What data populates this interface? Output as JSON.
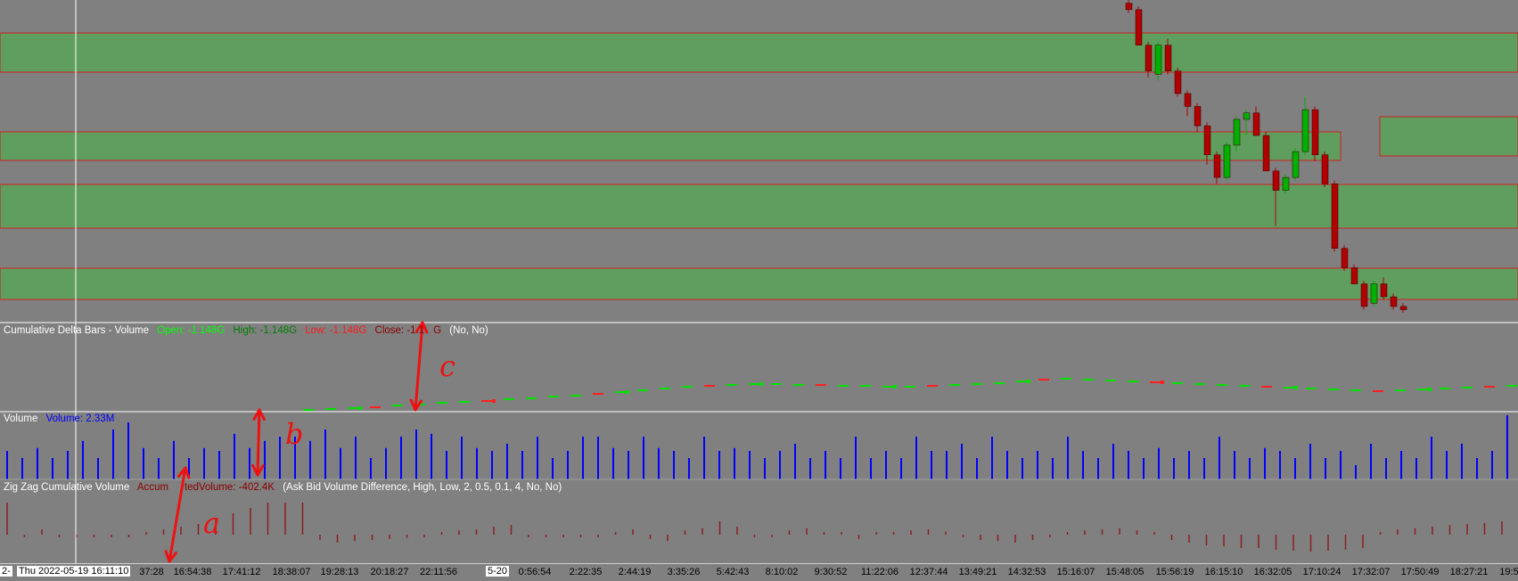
{
  "colors": {
    "background": "#808080",
    "zone_fill": "#5f9e5f",
    "zone_border": "#d02020",
    "candle_up": "#00b000",
    "candle_down": "#b00000",
    "volume_bar": "#0000ff",
    "zigzag_bar": "#8b2020",
    "annotation": "#ee1111",
    "crosshair": "#ffffff"
  },
  "panels": {
    "cumdelta": {
      "name": "Cumulative Delta Bars - Volume",
      "open": "Open: -1.148G",
      "high": "High: -1.148G",
      "low": "Low: -1.148G",
      "close": "Close: -1.1",
      "close_tail": "G",
      "params": "(No, No)"
    },
    "volume": {
      "name": "Volume",
      "value": "Volume: 2.33M"
    },
    "zigzag": {
      "name": "Zig Zag Cumulative Volume",
      "accum_a": "Accum",
      "accum_b": "tedVolume: -402.4K",
      "params": "(Ask Bid Volume Difference, High, Low, 2, 0.5, 0.1, 4, No, No)"
    }
  },
  "annotations": {
    "a": "a",
    "b": "b",
    "c": "c"
  },
  "time_axis": {
    "left_cut": "2-",
    "crosshair_time": "Thu 2022-05-19  16:11:10",
    "date_marker": "5-20",
    "ticks": [
      "37:28",
      "16:54:38",
      "17:41:12",
      "18:38:07",
      "19:28:13",
      "20:18:27",
      "22:11:56",
      "0:56:54",
      "2:22:35",
      "2:44:19",
      "3:35:26",
      "5:42:43",
      "8:10:02",
      "9:30:52",
      "11:22:06",
      "12:37:44",
      "13:49:21",
      "14:32:53",
      "15:16:07",
      "15:48:05",
      "15:56:19",
      "16:15:10",
      "16:32:05",
      "17:10:24",
      "17:32:07",
      "17:50:49",
      "18:27:21",
      "19:5"
    ]
  },
  "chart_data": {
    "type": "candlestick",
    "price_candles_ohlc_relative": [
      [
        0.99,
        0.97,
        1.0,
        0.96
      ],
      [
        0.97,
        0.86,
        0.98,
        0.86
      ],
      [
        0.86,
        0.78,
        0.87,
        0.76
      ],
      [
        0.77,
        0.86,
        0.87,
        0.75
      ],
      [
        0.86,
        0.78,
        0.88,
        0.77
      ],
      [
        0.78,
        0.71,
        0.79,
        0.7
      ],
      [
        0.71,
        0.67,
        0.72,
        0.64
      ],
      [
        0.67,
        0.61,
        0.68,
        0.59
      ],
      [
        0.61,
        0.52,
        0.62,
        0.49
      ],
      [
        0.52,
        0.45,
        0.53,
        0.43
      ],
      [
        0.45,
        0.55,
        0.56,
        0.44
      ],
      [
        0.55,
        0.63,
        0.64,
        0.53
      ],
      [
        0.63,
        0.65,
        0.66,
        0.58
      ],
      [
        0.65,
        0.58,
        0.67,
        0.58
      ],
      [
        0.58,
        0.47,
        0.59,
        0.47
      ],
      [
        0.47,
        0.41,
        0.48,
        0.3
      ],
      [
        0.41,
        0.45,
        0.46,
        0.4
      ],
      [
        0.45,
        0.53,
        0.54,
        0.44
      ],
      [
        0.53,
        0.66,
        0.7,
        0.52
      ],
      [
        0.66,
        0.52,
        0.67,
        0.5
      ],
      [
        0.52,
        0.43,
        0.53,
        0.42
      ],
      [
        0.43,
        0.23,
        0.44,
        0.22
      ],
      [
        0.23,
        0.17,
        0.24,
        0.16
      ],
      [
        0.17,
        0.12,
        0.18,
        0.12
      ],
      [
        0.12,
        0.05,
        0.13,
        0.04
      ],
      [
        0.06,
        0.12,
        0.13,
        0.05
      ],
      [
        0.12,
        0.08,
        0.14,
        0.07
      ],
      [
        0.08,
        0.05,
        0.09,
        0.04
      ],
      [
        0.05,
        0.04,
        0.06,
        0.03
      ]
    ],
    "volume_bars_relative": [
      0.2,
      0.15,
      0.22,
      0.15,
      0.2,
      0.27,
      0.15,
      0.35,
      0.4,
      0.22,
      0.15,
      0.27,
      0.15,
      0.22,
      0.2,
      0.32,
      0.22,
      0.27,
      0.3,
      0.3,
      0.27,
      0.35,
      0.22,
      0.3,
      0.15,
      0.22,
      0.3,
      0.35,
      0.32,
      0.2,
      0.3,
      0.22,
      0.2,
      0.25,
      0.2,
      0.3,
      0.15,
      0.2,
      0.3,
      0.3,
      0.22,
      0.2,
      0.3,
      0.22,
      0.2,
      0.15,
      0.3,
      0.2,
      0.22,
      0.2,
      0.15,
      0.2,
      0.25,
      0.15,
      0.2,
      0.15,
      0.3,
      0.15,
      0.2,
      0.15,
      0.3,
      0.2,
      0.2,
      0.25,
      0.15,
      0.3,
      0.2,
      0.15,
      0.2,
      0.15,
      0.3,
      0.2,
      0.15,
      0.25,
      0.2,
      0.15,
      0.22,
      0.15,
      0.2,
      0.15,
      0.3,
      0.2,
      0.15,
      0.22,
      0.2,
      0.15,
      0.25,
      0.15,
      0.2,
      0.1,
      0.25,
      0.15,
      0.2,
      0.15,
      0.3,
      0.2,
      0.25,
      0.15,
      0.2,
      0.45
    ],
    "zigzag_bars_relative": [
      0.6,
      -0.05,
      0.1,
      -0.05,
      -0.05,
      -0.05,
      -0.05,
      -0.05,
      0.05,
      0.1,
      0.15,
      0.2,
      0.3,
      0.4,
      0.5,
      0.6,
      0.6,
      0.6,
      -0.1,
      -0.15,
      -0.12,
      -0.1,
      -0.08,
      -0.06,
      -0.05,
      0.05,
      0.08,
      0.1,
      0.15,
      0.18,
      -0.05,
      -0.05,
      -0.05,
      -0.05,
      -0.05,
      0.05,
      0.1,
      -0.08,
      -0.12,
      0.08,
      0.12,
      0.25,
      0.15,
      -0.05,
      -0.05,
      0.08,
      0.12,
      0.05,
      0.05,
      -0.08,
      0.05,
      0.05,
      0.08,
      0.1,
      0.06,
      -0.05,
      -0.1,
      -0.12,
      -0.15,
      -0.1,
      -0.05,
      0.05,
      0.08,
      0.1,
      0.12,
      0.08,
      0.05,
      -0.1,
      -0.15,
      -0.2,
      -0.22,
      -0.25,
      -0.25,
      -0.28,
      -0.3,
      -0.32,
      -0.3,
      -0.28,
      -0.25,
      0.05,
      0.1,
      0.12,
      0.15,
      0.18,
      0.2,
      0.22,
      0.25
    ]
  }
}
